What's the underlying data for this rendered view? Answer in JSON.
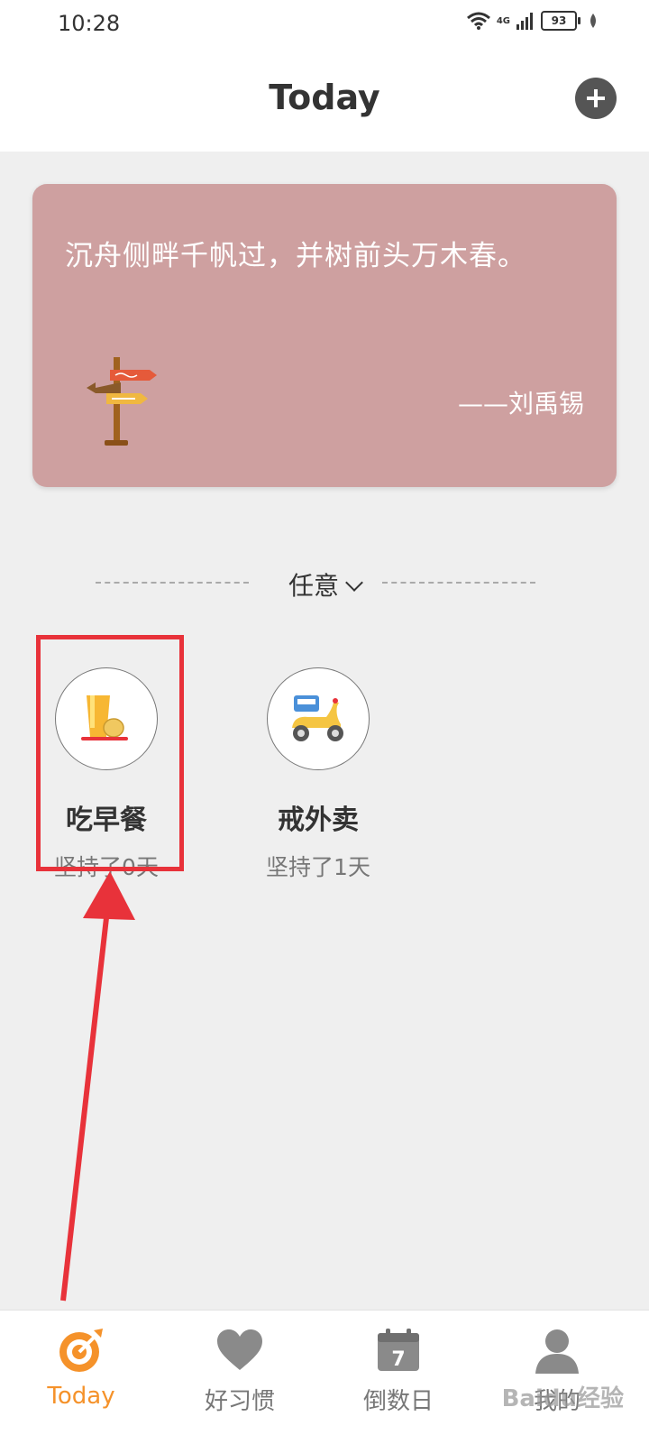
{
  "status_bar": {
    "time": "10:28",
    "network": "4G",
    "battery": "93"
  },
  "header": {
    "title": "Today",
    "add_icon": "plus-icon"
  },
  "quote_card": {
    "text": "沉舟侧畔千帆过，并树前头万木春。",
    "author": "——刘禹锡",
    "background": "#cea0a0",
    "illustration": "signpost-icon"
  },
  "filter": {
    "label": "任意"
  },
  "habits": [
    {
      "name": "吃早餐",
      "days": "坚持了0天",
      "icon": "breakfast-icon"
    },
    {
      "name": "戒外卖",
      "days": "坚持了1天",
      "icon": "delivery-scooter-icon"
    }
  ],
  "tabs": [
    {
      "label": "Today",
      "icon": "target-icon"
    },
    {
      "label": "好习惯",
      "icon": "heart-icon"
    },
    {
      "label": "倒数日",
      "icon": "calendar-icon",
      "icon_number": "7"
    },
    {
      "label": "我的",
      "icon": "user-icon"
    }
  ],
  "watermark": "Baidu经验",
  "colors": {
    "accent": "#f5922a",
    "highlight": "#e8323a"
  }
}
